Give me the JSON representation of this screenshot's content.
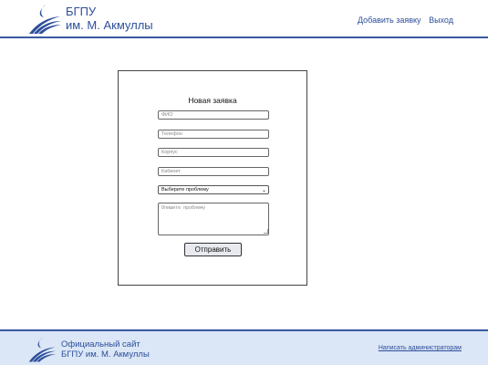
{
  "header": {
    "brand_line1": "БГПУ",
    "brand_line2": "им. М. Акмуллы",
    "nav": {
      "add_request": "Добавить заявку",
      "logout": "Выход"
    }
  },
  "form": {
    "title": "Новая заявка",
    "fio_placeholder": "ФИО",
    "phone_placeholder": "Телефон",
    "building_placeholder": "Корпус",
    "office_placeholder": "Кабинет",
    "problem_select_value": "Выберите проблему",
    "description_placeholder": "Опишите проблему",
    "submit_label": "Отправить"
  },
  "footer": {
    "brand_line1": "Официальный сайт",
    "brand_line2": "БГПУ им. М. Акмуллы",
    "contact_admins": "Написать администраторам"
  },
  "colors": {
    "brand_blue": "#2d4f9a",
    "footer_bg": "#dbe6f6"
  },
  "icons": {
    "logo": "bspu-wave-logo-icon",
    "select_chevron": "chevron-down-icon"
  }
}
